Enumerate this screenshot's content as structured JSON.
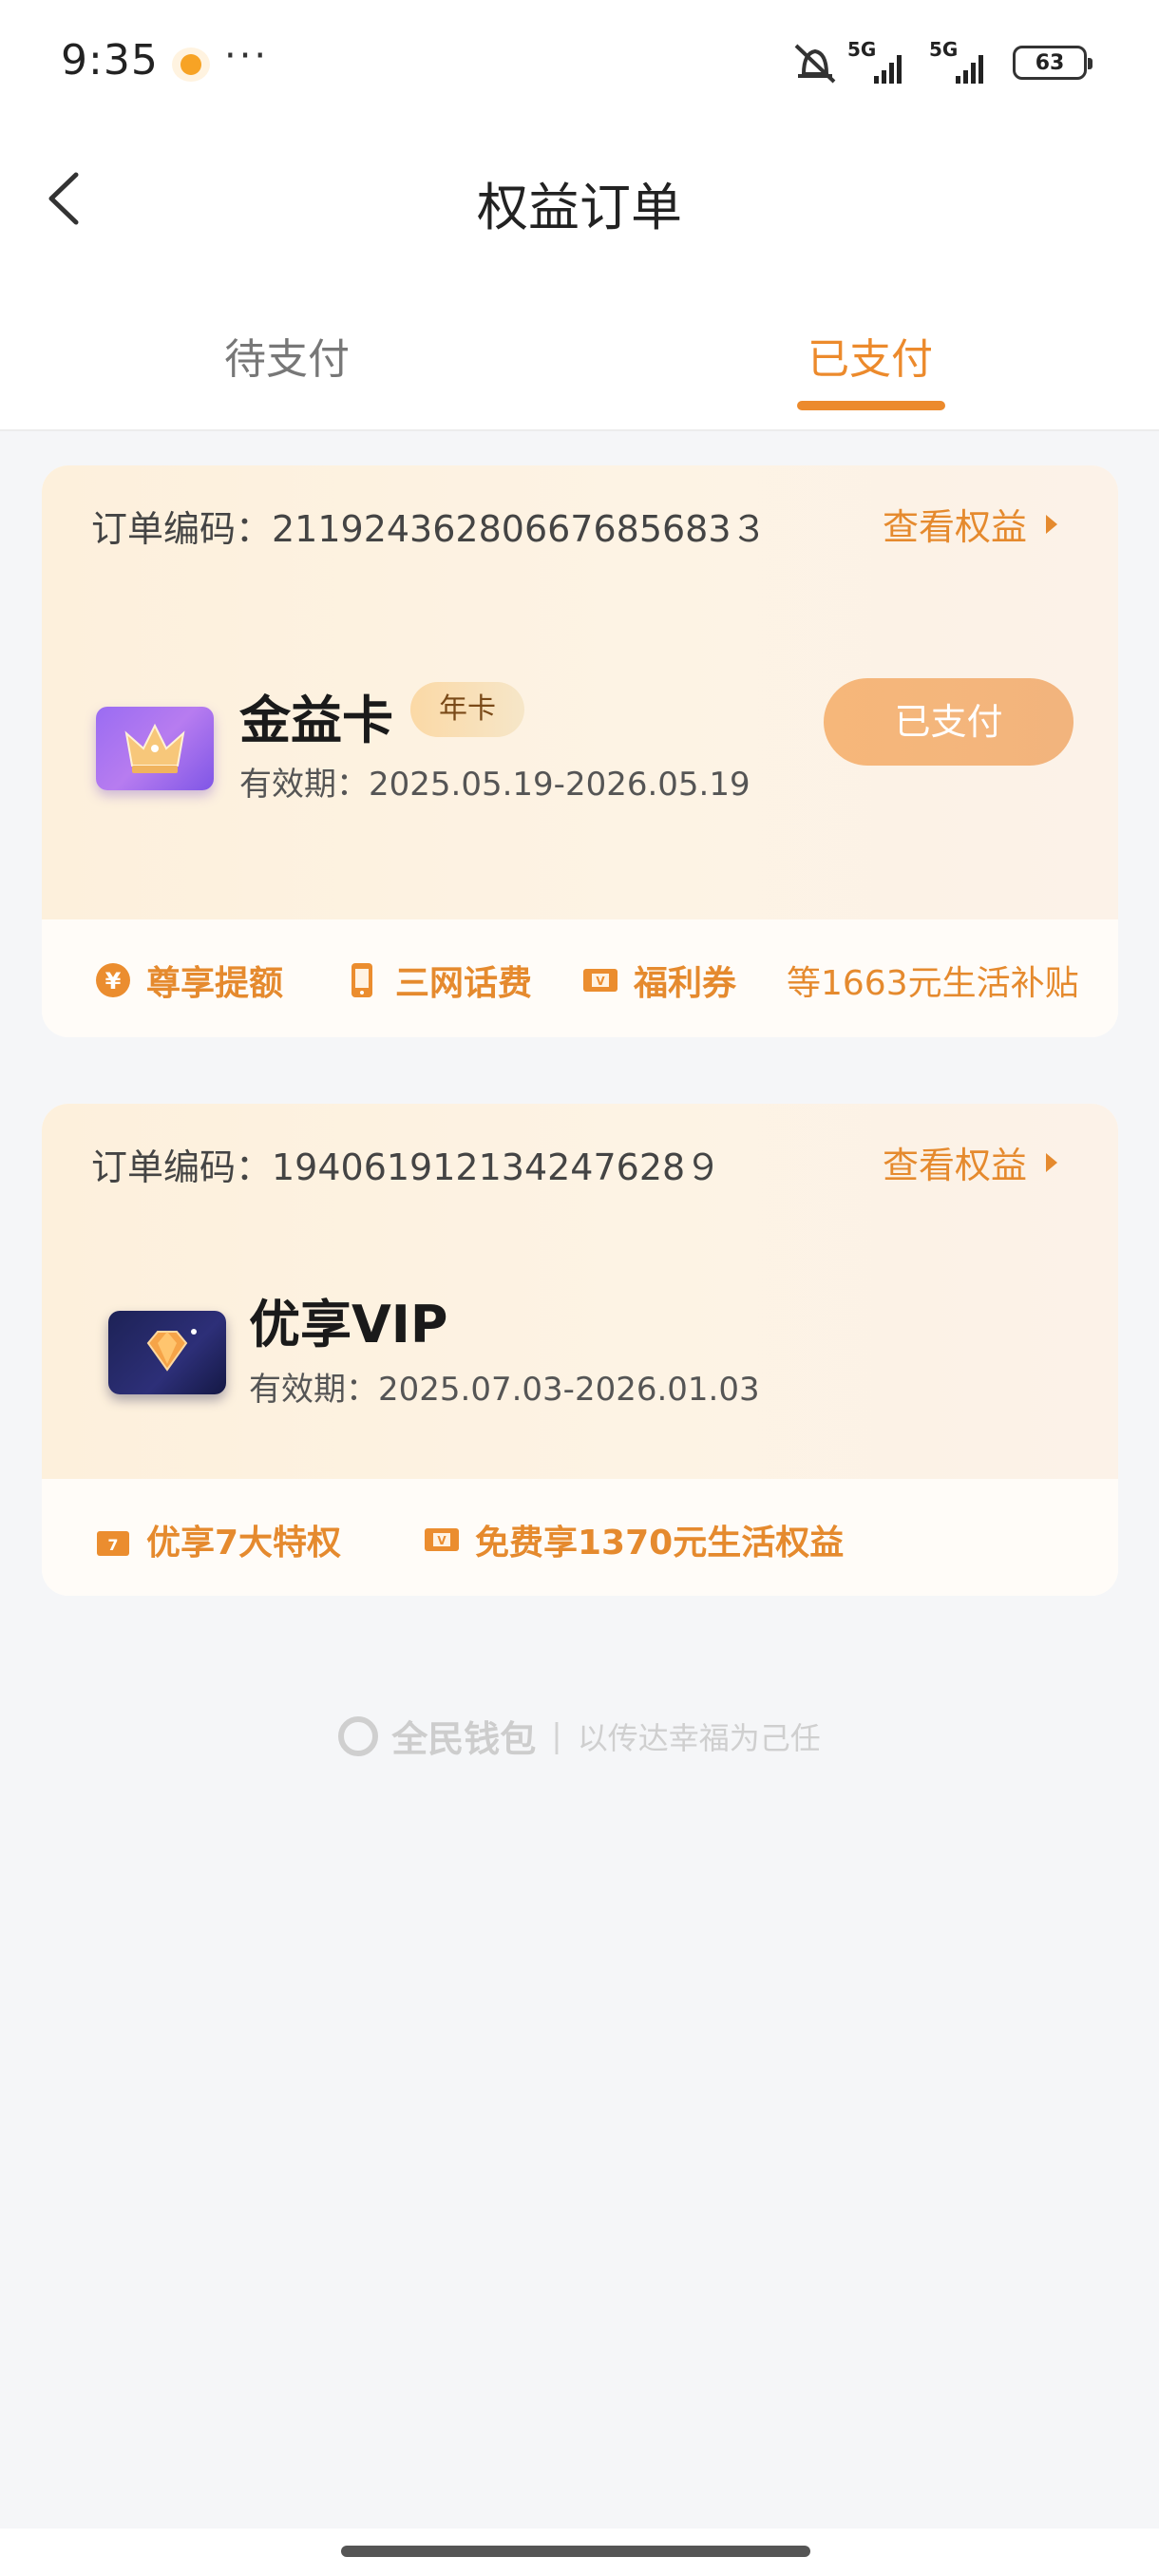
{
  "status_bar": {
    "time": "9:35",
    "more": "···",
    "net1": "5G",
    "net2": "5G",
    "battery": "63"
  },
  "header": {
    "title": "权益订单"
  },
  "tabs": [
    {
      "label": "待支付",
      "active": false
    },
    {
      "label": "已支付",
      "active": true
    }
  ],
  "orders": [
    {
      "order_no": "订单编码：21192436280667685683３",
      "view_label": "查看权益",
      "product_name": "金益卡",
      "badge": "年卡",
      "validity": "有效期：2025.05.19-2026.05.19",
      "button": "已支付",
      "features": [
        "尊享提额",
        "三网话费",
        "福利券",
        "等1663元生活补贴"
      ]
    },
    {
      "order_no": "订单编码：194061912134247628９",
      "view_label": "查看权益",
      "product_name": "优享VIP",
      "validity": "有效期：2025.07.03-2026.01.03",
      "features": [
        "优享7大特权",
        "免费享1370元生活权益"
      ]
    }
  ],
  "footer": {
    "brand": "全民钱包",
    "separator": "|",
    "slogan": "以传达幸福为己任"
  },
  "colors": {
    "accent": "#ec8a2c",
    "card_bg": "#fdf0dc",
    "paid_button": "#f6b77a"
  }
}
